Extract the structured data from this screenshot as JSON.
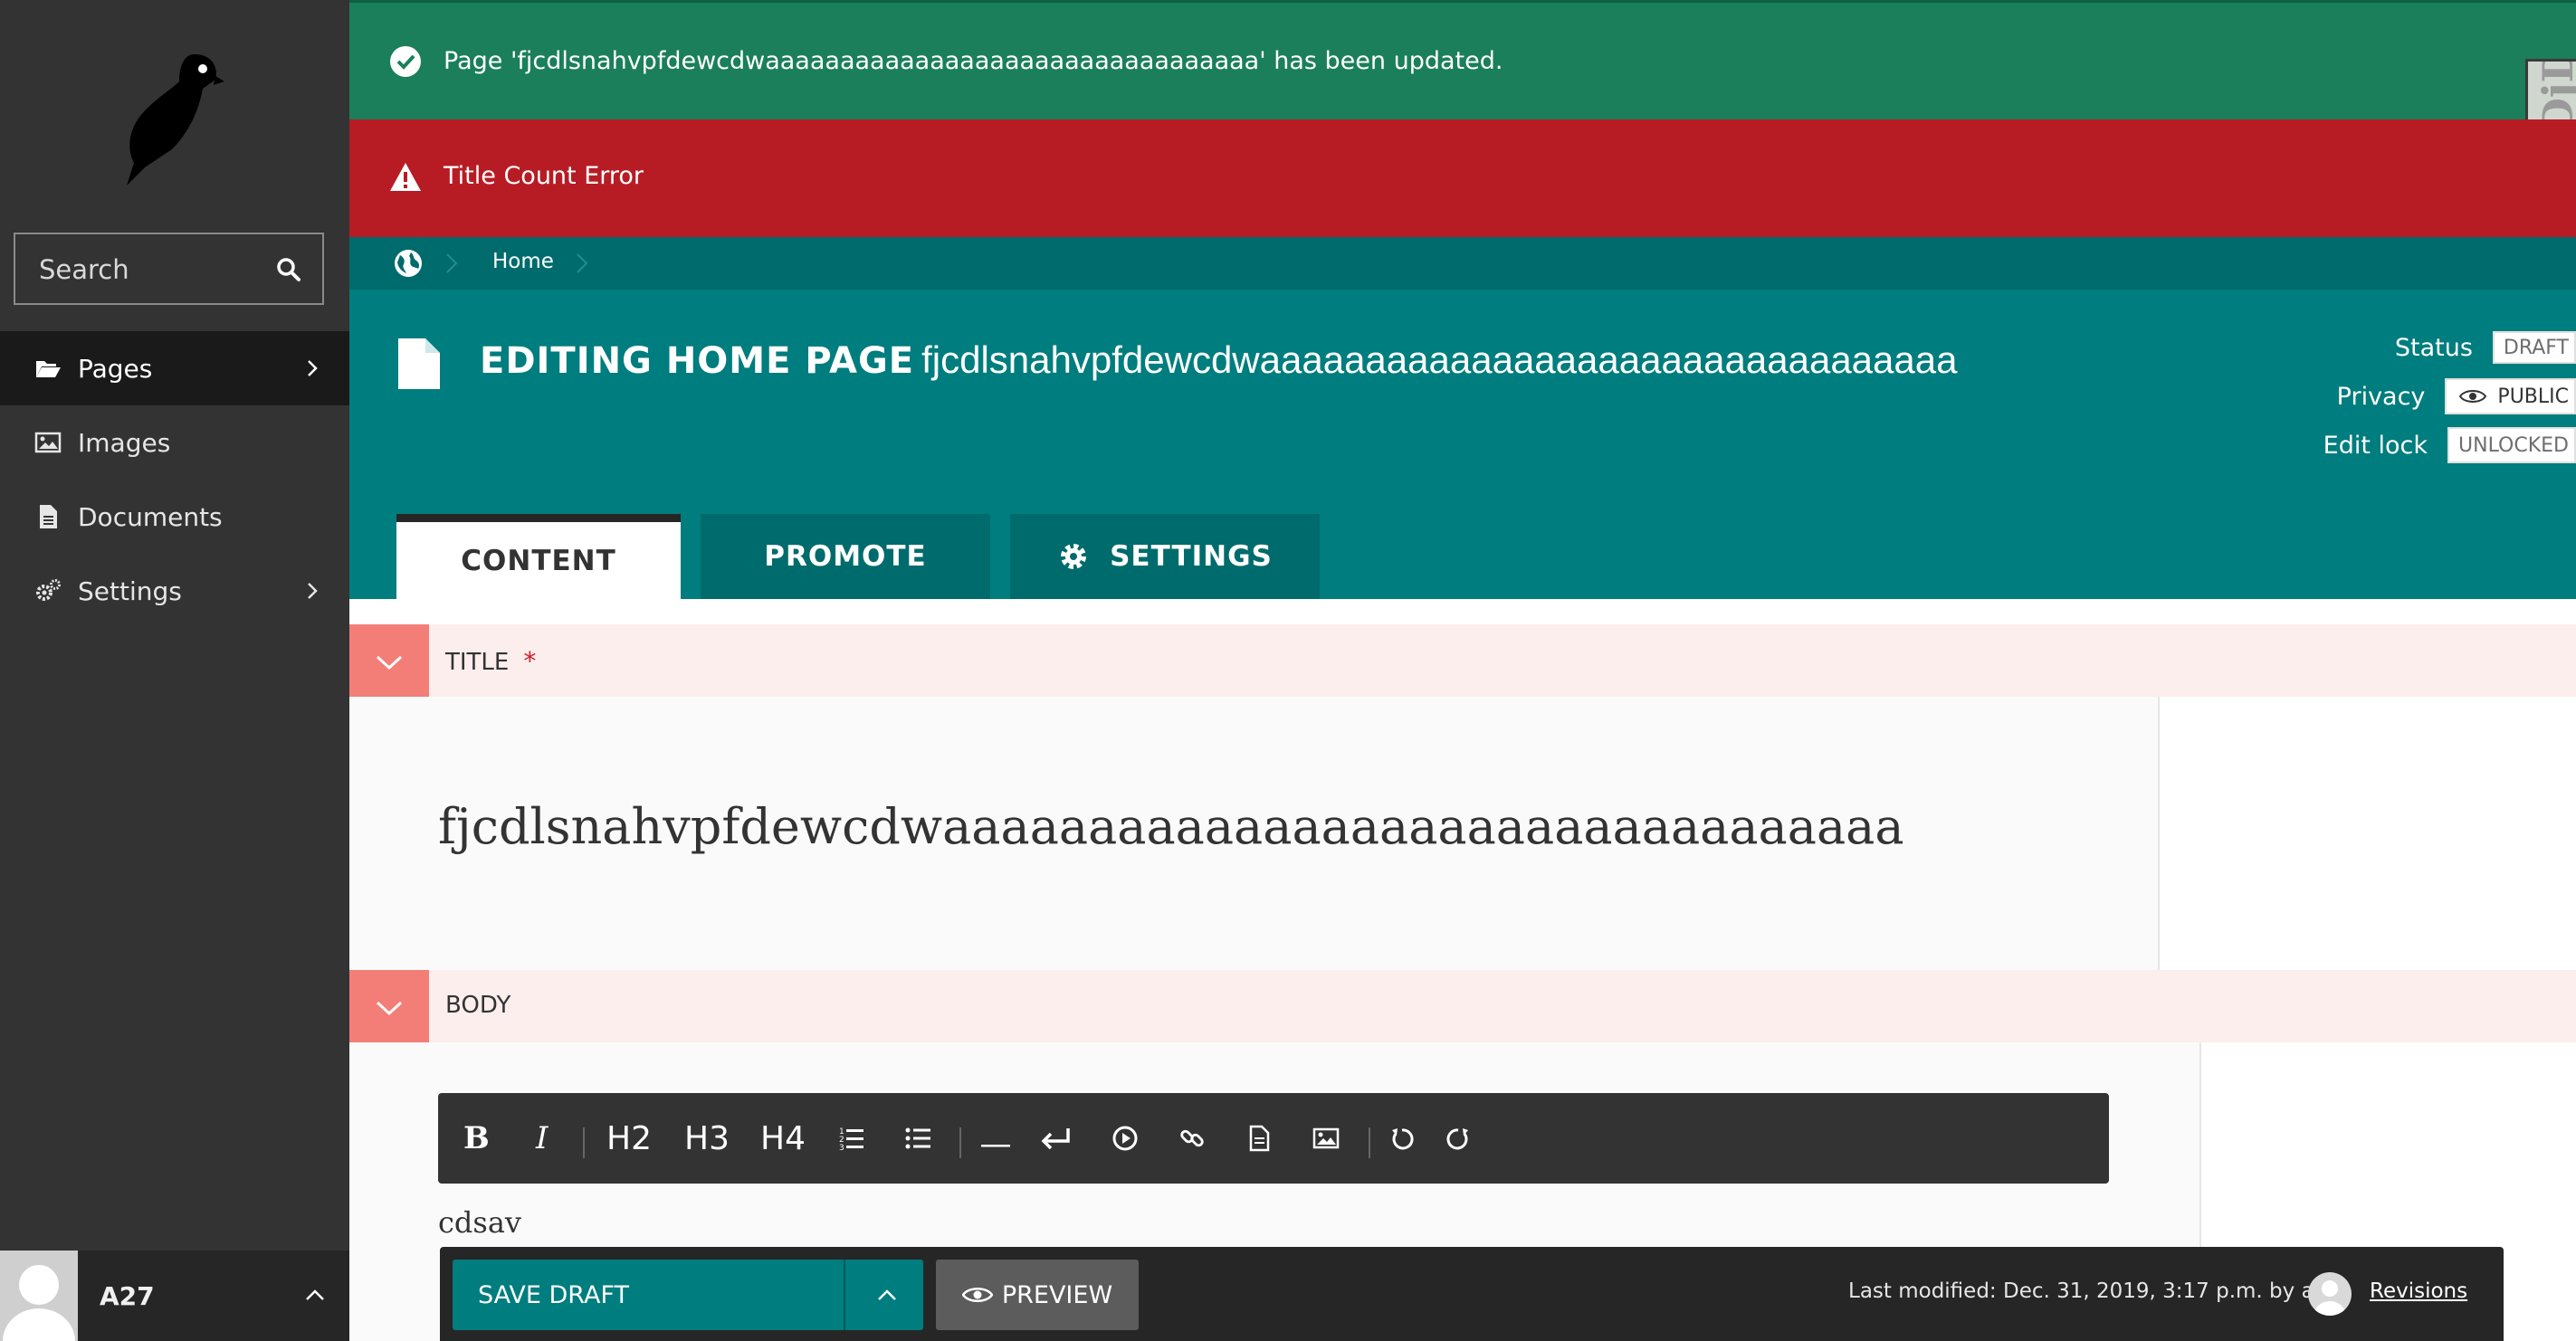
{
  "sidebar": {
    "search_label": "Search",
    "items": [
      {
        "label": "Pages",
        "icon": "folder-open-icon",
        "has_submenu": true,
        "active": true
      },
      {
        "label": "Images",
        "icon": "image-icon",
        "has_submenu": false
      },
      {
        "label": "Documents",
        "icon": "document-icon",
        "has_submenu": false
      },
      {
        "label": "Settings",
        "icon": "cogs-icon",
        "has_submenu": true
      }
    ],
    "user": {
      "name": "A27"
    }
  },
  "messages": {
    "success": "Page 'fjcdlsnahvpfdewcdwaaaaaaaaaaaaaaaaaaaaaaaaaaaaaaaaa' has been updated.",
    "error": "Title Count Error",
    "side_tab": "DjDT"
  },
  "breadcrumb": {
    "home": "Home"
  },
  "header": {
    "title_prefix": "EDITING HOME PAGE",
    "title_page": "fjcdlsnahvpfdewcdwaaaaaaaaaaaaaaaaaaaaaaaaaaaaaaaaa",
    "status_label": "Status",
    "status_value": "DRAFT",
    "privacy_label": "Privacy",
    "privacy_value": "PUBLIC",
    "lock_label": "Edit lock",
    "lock_value": "UNLOCKED"
  },
  "tabs": [
    {
      "label": "CONTENT",
      "active": true
    },
    {
      "label": "PROMOTE"
    },
    {
      "label": "SETTINGS"
    }
  ],
  "fields": {
    "title_label": "TITLE",
    "required_mark": "*",
    "title_value": "fjcdlsnahvpfdewcdwaaaaaaaaaaaaaaaaaaaaaaaaaaaaaaaaa",
    "body_label": "BODY",
    "body_text": "cdsav"
  },
  "toolbar": {
    "bold": "B",
    "italic": "I",
    "h2": "H2",
    "h3": "H3",
    "h4": "H4"
  },
  "footer": {
    "save_label": "SAVE DRAFT",
    "preview_label": "PREVIEW",
    "last_modified": "Last modified: Dec. 31, 2019, 3:17 p.m. by a27",
    "revisions_label": "Revisions"
  },
  "colors": {
    "teal": "#007d7e",
    "teal_dark": "#006b6c",
    "success": "#1a7f5a",
    "error": "#b71c24",
    "sidebar": "#333333",
    "salmon": "#f37e77"
  }
}
